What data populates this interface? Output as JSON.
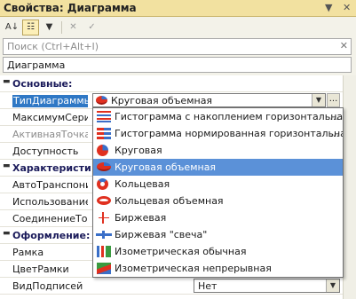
{
  "window": {
    "title": "Свойства: Диаграмма",
    "pin_glyph": "▼",
    "close_glyph": "✕"
  },
  "toolbar": {
    "buttons": [
      {
        "name": "sort-az-icon",
        "glyph": "A↓"
      },
      {
        "name": "group-categories-icon",
        "glyph": "☷"
      },
      {
        "name": "filter-icon",
        "glyph": "▼"
      },
      {
        "name": "clear-icon",
        "glyph": "✕"
      },
      {
        "name": "apply-icon",
        "glyph": "✓"
      }
    ]
  },
  "search": {
    "placeholder": "Поиск (Ctrl+Alt+I)",
    "clear_glyph": "✕"
  },
  "object_selector": {
    "value": "Диаграмма"
  },
  "properties": [
    {
      "label": "Основные:",
      "group": true
    },
    {
      "label": "ТипДиаграммы",
      "value": "Круговая объемная",
      "selected": true
    },
    {
      "label": "МаксимумСерий"
    },
    {
      "label": "АктивнаяТочка",
      "dim": true
    },
    {
      "label": "Доступность"
    },
    {
      "label": "Характеристик",
      "group": true
    },
    {
      "label": "АвтоТранспониро"
    },
    {
      "label": "ИспользованиеН"
    },
    {
      "label": "СоединениеТочек"
    },
    {
      "label": "Оформление:",
      "group": true
    },
    {
      "label": "Рамка"
    },
    {
      "label": "ЦветРамки"
    },
    {
      "label": "ВидПодписей",
      "value": "Нет"
    }
  ],
  "dropdown": {
    "items": [
      {
        "label": "Гистограмма с накоплением горизонтальная об",
        "icon": "bars",
        "icon_name": "stacked-bar-chart-icon",
        "ellipsis": "..."
      },
      {
        "label": "Гистограмма нормированная горизонтальная о",
        "icon": "bars2",
        "icon_name": "normalized-bar-chart-icon",
        "ellipsis": "..."
      },
      {
        "label": "Круговая",
        "icon": "pie2d",
        "icon_name": "pie-chart-icon"
      },
      {
        "label": "Круговая объемная",
        "icon": "pie3d",
        "icon_name": "pie-3d-chart-icon",
        "highlighted": true
      },
      {
        "label": "Кольцевая",
        "icon": "ring",
        "icon_name": "doughnut-chart-icon"
      },
      {
        "label": "Кольцевая объемная",
        "icon": "ring3d",
        "icon_name": "doughnut-3d-chart-icon"
      },
      {
        "label": "Биржевая",
        "icon": "stock",
        "icon_name": "stock-chart-icon"
      },
      {
        "label": "Биржевая \"свеча\"",
        "icon": "candle",
        "icon_name": "candlestick-chart-icon"
      },
      {
        "label": "Изометрическая обычная",
        "icon": "iso",
        "icon_name": "isometric-chart-icon"
      },
      {
        "label": "Изометрическая непрерывная",
        "icon": "iso2",
        "icon_name": "isometric-continuous-chart-icon"
      }
    ]
  },
  "colors": {
    "title_bg": "#f2e1a0",
    "selection": "#2f78c5",
    "highlight": "#5b91d8",
    "red": "#e03020",
    "blue": "#3a6fc8"
  }
}
